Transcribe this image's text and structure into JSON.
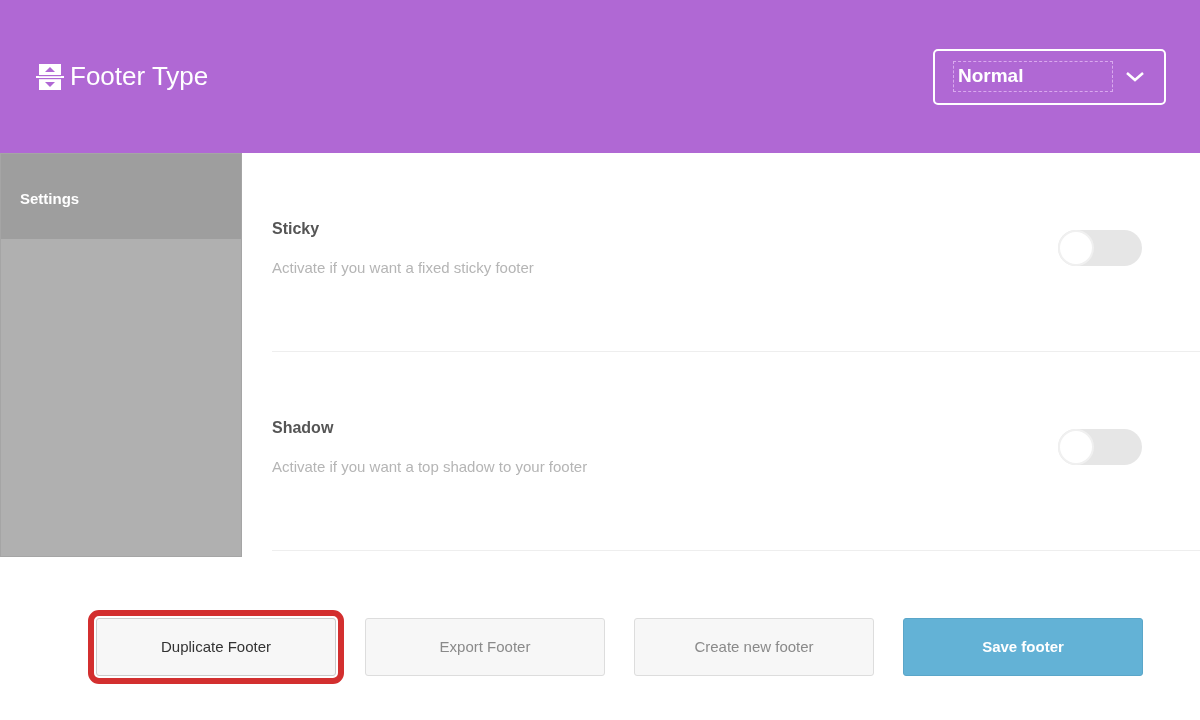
{
  "header": {
    "title": "Footer Type",
    "select": {
      "value": "Normal"
    }
  },
  "sidebar": {
    "items": [
      {
        "label": "Settings",
        "selected": true
      }
    ]
  },
  "settings": [
    {
      "title": "Sticky",
      "description": "Activate if you want a fixed sticky footer",
      "on": false
    },
    {
      "title": "Shadow",
      "description": "Activate if you want a top shadow to your footer",
      "on": false
    }
  ],
  "buttons": [
    {
      "label": "Duplicate Footer",
      "kind": "default",
      "highlighted": true
    },
    {
      "label": "Export Footer",
      "kind": "muted",
      "highlighted": false
    },
    {
      "label": "Create new footer",
      "kind": "muted",
      "highlighted": false
    },
    {
      "label": "Save footer",
      "kind": "primary",
      "highlighted": false
    }
  ]
}
